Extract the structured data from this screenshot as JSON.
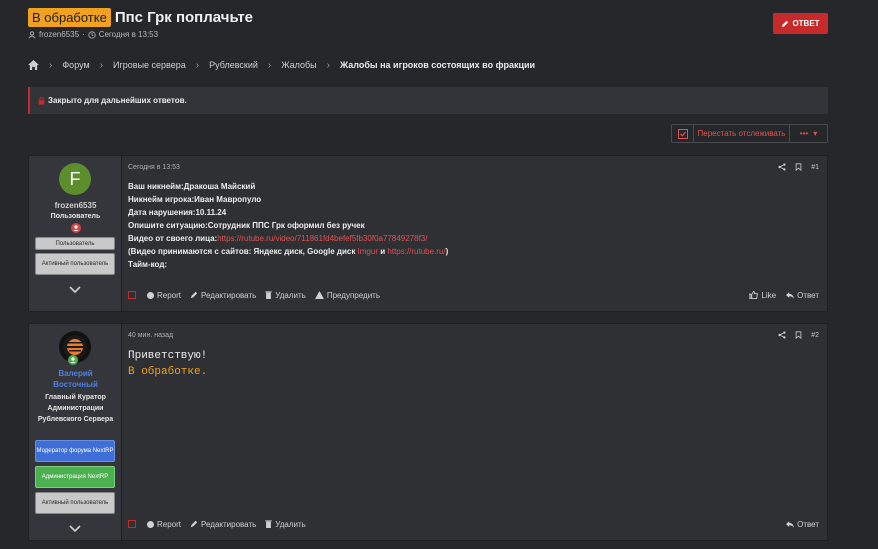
{
  "thread": {
    "prefix": "В обработке",
    "title": "Ппс Грк поплачьте",
    "author": "frozen6535",
    "date": "Сегодня в 13:53"
  },
  "reply_button": "ОТВЕТ",
  "breadcrumb": [
    "Форум",
    "Игровые сервера",
    "Рублевский",
    "Жалобы",
    "Жалобы на игроков состоящих во фракции"
  ],
  "closed_notice": "Закрыто для дальнейших ответов.",
  "watch": {
    "label": "Перестать отслеживать",
    "more": "•••"
  },
  "posts": [
    {
      "user": "frozen6535",
      "user_title": "Пользователь",
      "avatar_letter": "F",
      "avatar_color": "#5c8e2e",
      "banners": [
        "Пользователь",
        "Активный пользователь"
      ],
      "date": "Сегодня в 13:53",
      "number": "#1",
      "lines": [
        "Ваш никнейм:Дракоша Майский",
        "Никнейм игрока:Иван Мавропуло",
        "Дата нарушения:10.11.24",
        "Опишите ситуацию:Сотрудник ППС Грк оформил без ручек"
      ],
      "video_label": "Видео от своего лица:",
      "video_link": "https://rutube.ru/video/711861fd4befef5fb30f0a77849278f3/",
      "sites_prefix": "(Видео принимаются с сайтов: Яндекс диск, Google диск ",
      "sites_imgur": "Imgur",
      "sites_and": " и ",
      "sites_rutube": "https://rutube.ru/",
      "sites_suffix": ")",
      "timecode": "Тайм-код:",
      "actions": [
        "Report",
        "Редактировать",
        "Удалить",
        "Предупредить"
      ],
      "like": "Like",
      "reply": "Ответ"
    },
    {
      "user": "Валерий Восточный",
      "user_title": "Главный Куратор Администрации Рублевского Сервера",
      "banners": [
        "Модератор форума NextRP",
        "Администрация NextRP",
        "Активный пользователь"
      ],
      "date": "40 мин. назад",
      "number": "#2",
      "greeting": "Приветствую!",
      "status": "В обработке.",
      "actions": [
        "Report",
        "Редактировать",
        "Удалить"
      ],
      "reply": "Ответ"
    }
  ],
  "colors": {
    "accent": "#c62a2a",
    "prefix": "#f0a11f",
    "link": "#e05252",
    "mod_banner": "#3e6fd8",
    "admin_banner": "#4caf50"
  }
}
